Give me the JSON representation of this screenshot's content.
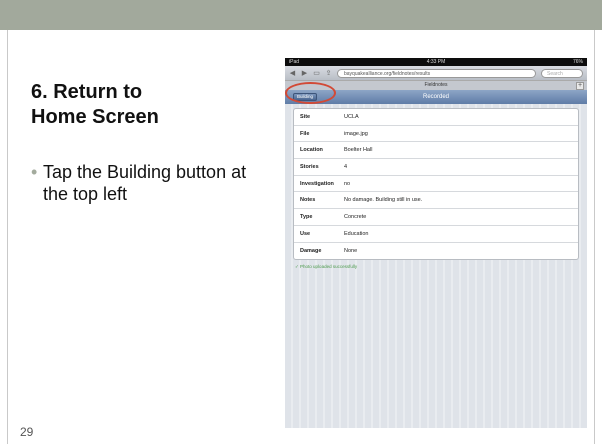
{
  "slide": {
    "title_line1": "6. Return to",
    "title_line2": "Home Screen",
    "bullet": "Tap the Building button at the top left",
    "page_number": "29"
  },
  "ipad": {
    "status": {
      "left": "iPad",
      "time": "4:33 PM",
      "battery": "76%"
    },
    "url": "bayquakealliance.org/fieldnotes/results",
    "search_placeholder": "Search",
    "tab_title": "Fieldnotes",
    "header_title": "Recorded",
    "back_button": "Building",
    "records": [
      {
        "label": "Site",
        "value": "UCLA"
      },
      {
        "label": "File",
        "value": "image.jpg"
      },
      {
        "label": "Location",
        "value": "Boelter Hall"
      },
      {
        "label": "Stories",
        "value": "4"
      },
      {
        "label": "Investigation",
        "value": "no"
      },
      {
        "label": "Notes",
        "value": "No damage. Building still in use."
      },
      {
        "label": "Type",
        "value": "Concrete"
      },
      {
        "label": "Use",
        "value": "Education"
      },
      {
        "label": "Damage",
        "value": "None"
      }
    ],
    "upload_status": "Photo uploaded successfully"
  },
  "colors": {
    "top_band": "#a2a99c",
    "header_blue": "#6e89b2",
    "highlight_red": "#d24a36"
  }
}
